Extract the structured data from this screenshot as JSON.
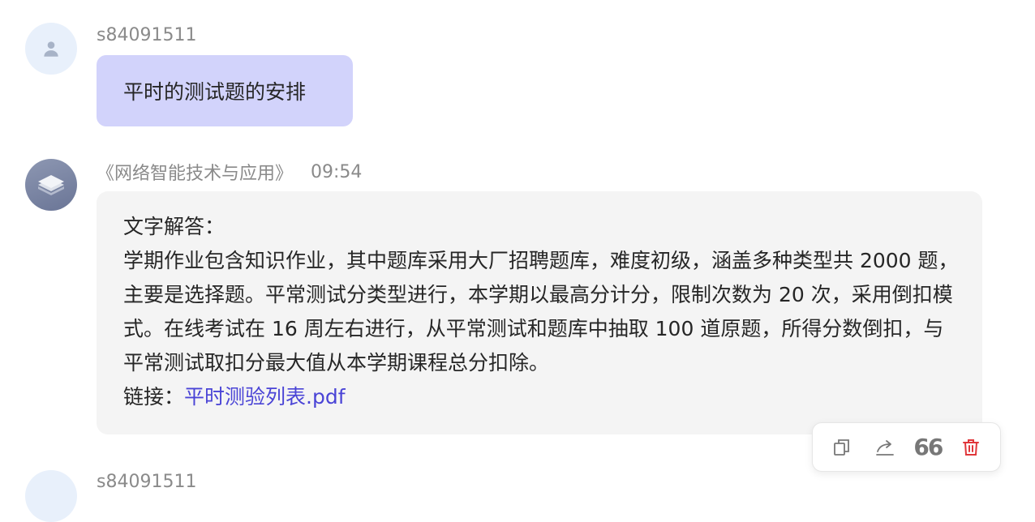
{
  "messages": [
    {
      "role": "user",
      "username": "s84091511",
      "text": "平时的测试题的安排"
    },
    {
      "role": "bot",
      "course": "《网络智能技术与应用》",
      "time": "09:54",
      "heading": "文字解答：",
      "body": "学期作业包含知识作业，其中题库采用大厂招聘题库，难度初级，涵盖多种类型共 2000 题，主要是选择题。平常测试分类型进行，本学期以最高分计分，限制次数为 20 次，采用倒扣模式。在线考试在 16 周左右进行，从平常测试和题库中抽取 100 道原题，所得分数倒扣，与平常测试取扣分最大值从本学期课程总分扣除。",
      "link_label": "链接：",
      "link_text": "平时测验列表.pdf"
    },
    {
      "role": "user",
      "username": "s84091511"
    }
  ],
  "action_bar": {
    "icons": [
      "copy-icon",
      "share-icon",
      "quote-icon",
      "delete-icon"
    ]
  },
  "colors": {
    "user_bubble": "#d2d3fb",
    "bot_bubble": "#f4f4f4",
    "link": "#4a44d6",
    "delete": "#e0363a"
  }
}
